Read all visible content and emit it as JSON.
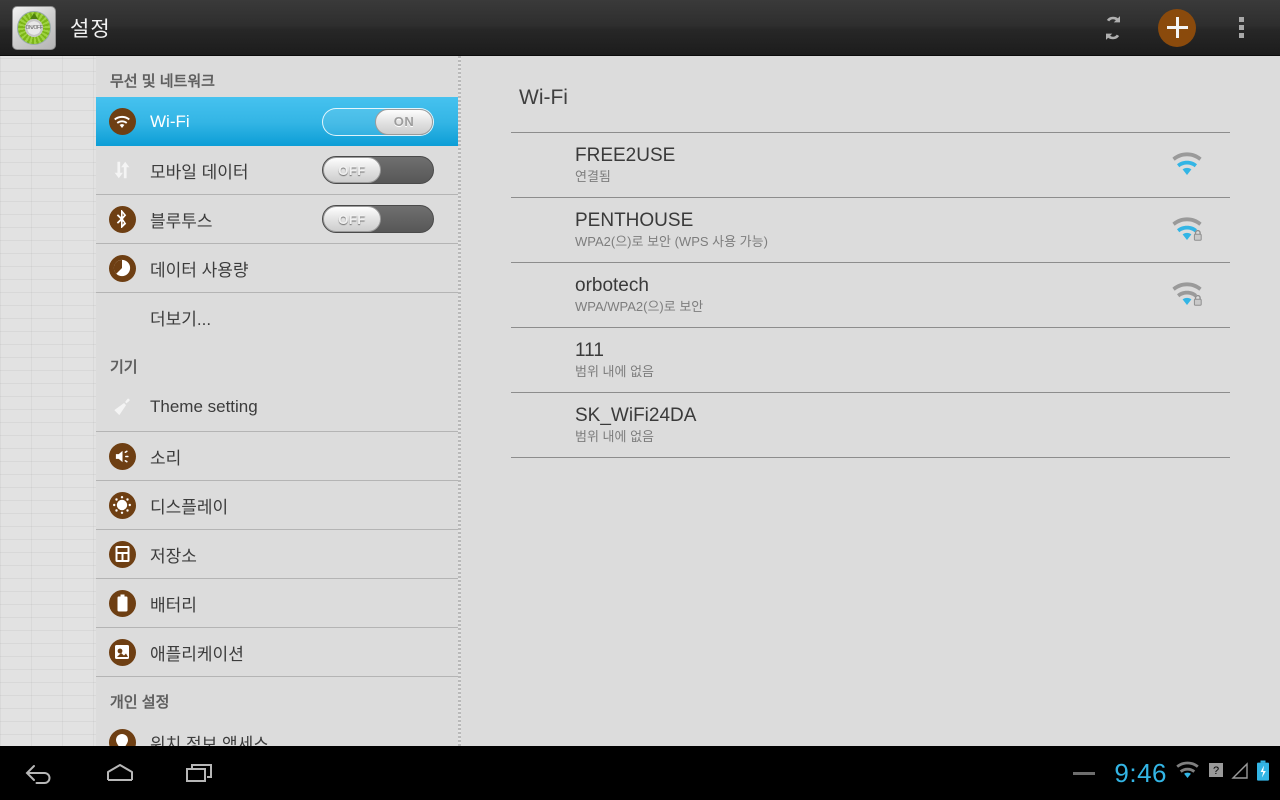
{
  "actionbar": {
    "title": "설정",
    "app_icon": "settings-dial-icon",
    "dial_label": "ON/OFF",
    "sync_icon": "sync-icon",
    "add_icon": "plus-icon",
    "overflow_icon": "overflow-menu-icon",
    "accent_orange": "#8a4a0c"
  },
  "sidebar": {
    "sections": [
      {
        "header": "무선 및 네트워크",
        "items": [
          {
            "label": "Wi-Fi",
            "icon": "wifi-icon",
            "selected": true,
            "toggle": "ON"
          },
          {
            "label": "모바일 데이터",
            "icon": "mobile-data-icon",
            "selected": false,
            "toggle": "OFF"
          },
          {
            "label": "블루투스",
            "icon": "bluetooth-icon",
            "selected": false,
            "toggle": "OFF"
          },
          {
            "label": "데이터 사용량",
            "icon": "data-usage-icon",
            "selected": false,
            "toggle": null
          },
          {
            "label": "더보기...",
            "icon": null,
            "selected": false,
            "toggle": null
          }
        ]
      },
      {
        "header": "기기",
        "items": [
          {
            "label": "Theme setting",
            "icon": "paintbrush-icon",
            "selected": false,
            "toggle": null
          },
          {
            "label": "소리",
            "icon": "sound-icon",
            "selected": false,
            "toggle": null
          },
          {
            "label": "디스플레이",
            "icon": "display-icon",
            "selected": false,
            "toggle": null
          },
          {
            "label": "저장소",
            "icon": "storage-icon",
            "selected": false,
            "toggle": null
          },
          {
            "label": "배터리",
            "icon": "battery-icon",
            "selected": false,
            "toggle": null
          },
          {
            "label": "애플리케이션",
            "icon": "applications-icon",
            "selected": false,
            "toggle": null
          }
        ]
      },
      {
        "header": "개인 설정",
        "items": [
          {
            "label": "위치 정보 액세스",
            "icon": "location-icon",
            "selected": false,
            "toggle": null
          }
        ]
      }
    ],
    "selected_highlight": "#33b5e5",
    "icon_color": "#6e3f13"
  },
  "content": {
    "title": "Wi-Fi",
    "networks": [
      {
        "ssid": "FREE2USE",
        "status": "연결됨",
        "signal": 2,
        "secured": false
      },
      {
        "ssid": "PENTHOUSE",
        "status": "WPA2(으)로 보안 (WPS 사용 가능)",
        "signal": 2,
        "secured": true
      },
      {
        "ssid": "orbotech",
        "status": "WPA/WPA2(으)로 보안",
        "signal": 1,
        "secured": true
      },
      {
        "ssid": "111",
        "status": "범위 내에 없음",
        "signal": 0,
        "secured": false
      },
      {
        "ssid": "SK_WiFi24DA",
        "status": "범위 내에 없음",
        "signal": 0,
        "secured": false
      }
    ]
  },
  "systembar": {
    "back_icon": "back-icon",
    "home_icon": "home-icon",
    "recents_icon": "recent-apps-icon",
    "clock": "9:46",
    "clock_color": "#33b5e5",
    "wifi_status_icon": "wifi-status-icon",
    "signal_unknown_icon": "signal-unknown-icon",
    "signal_bars_icon": "signal-bars-icon",
    "battery_icon": "battery-charging-icon"
  }
}
